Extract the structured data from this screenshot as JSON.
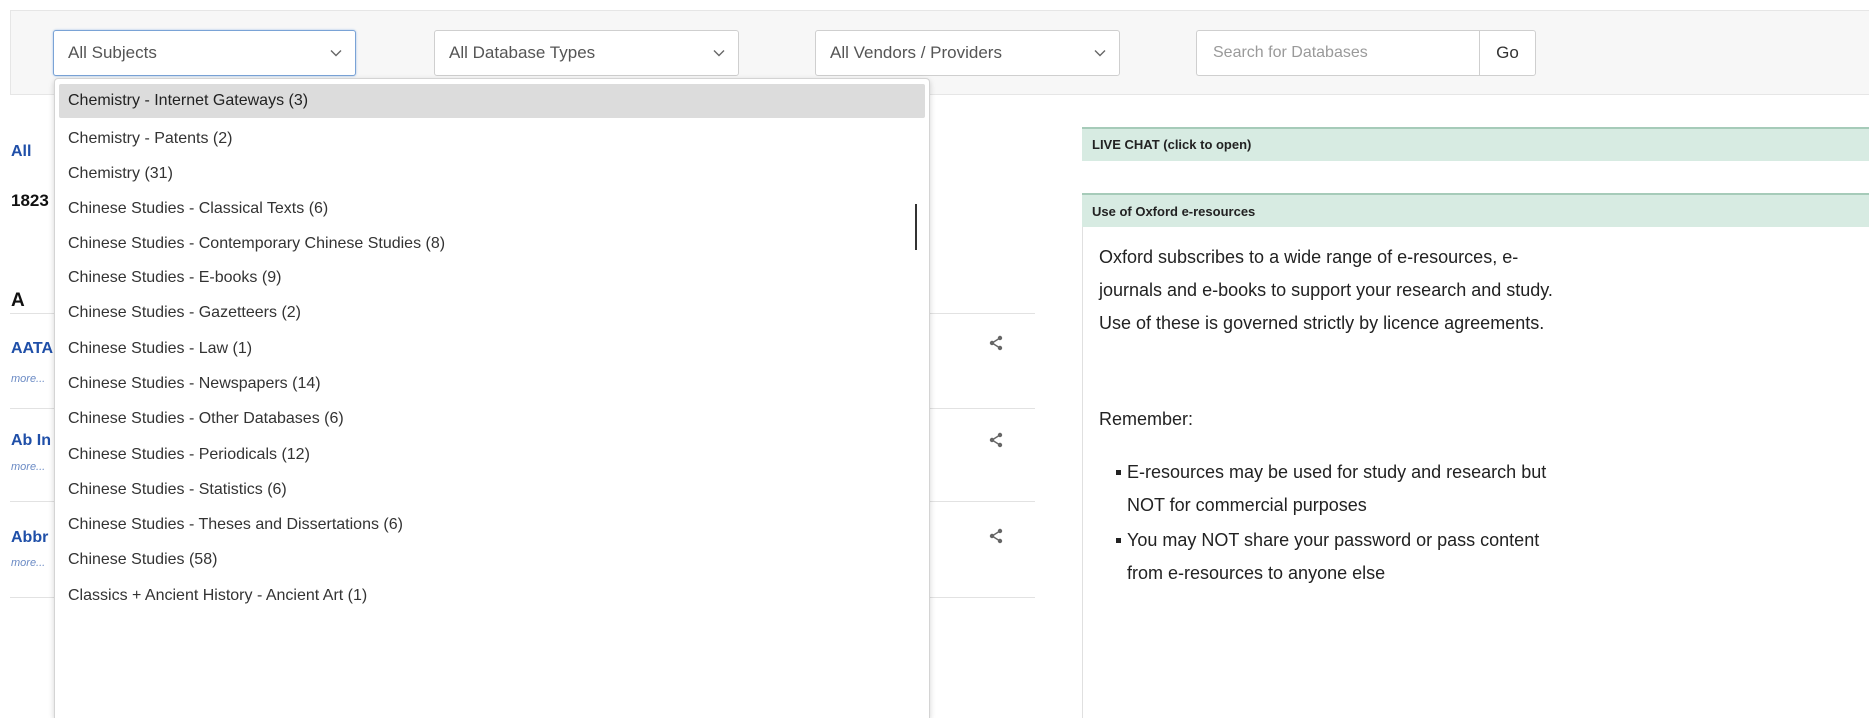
{
  "filters": {
    "subjects": {
      "selected": "All Subjects"
    },
    "types": {
      "selected": "All Database Types"
    },
    "vendors": {
      "selected": "All Vendors / Providers"
    },
    "search": {
      "placeholder": "Search for Databases",
      "value": ""
    },
    "go_label": "Go"
  },
  "list": {
    "az_all": "All",
    "count": "1823",
    "letter": "A",
    "items": [
      {
        "title": "AATA",
        "more": "more..."
      },
      {
        "title": "Ab In",
        "more": "more..."
      },
      {
        "title": "Abbr",
        "more": "more..."
      }
    ]
  },
  "dropdown": {
    "options": [
      "Chemistry - Internet Gateways (3)",
      "Chemistry - Patents (2)",
      "Chemistry (31)",
      "Chinese Studies - Classical Texts (6)",
      "Chinese Studies - Contemporary Chinese Studies (8)",
      "Chinese Studies - E-books (9)",
      "Chinese Studies - Gazetteers (2)",
      "Chinese Studies - Law (1)",
      "Chinese Studies - Newspapers (14)",
      "Chinese Studies - Other Databases (6)",
      "Chinese Studies - Periodicals (12)",
      "Chinese Studies - Statistics (6)",
      "Chinese Studies - Theses and Dissertations (6)",
      "Chinese Studies (58)",
      "Classics + Ancient History - Ancient Art (1)"
    ],
    "highlighted_index": 0
  },
  "sidebar": {
    "chat_label": "LIVE CHAT (click to open)",
    "oxford_title": "Use of Oxford e-resources",
    "oxford_para": "Oxford subscribes to a wide range of e-resources, e-journals and e-books to support your research and study. Use of these is governed strictly by licence agreements.",
    "remember": "Remember:",
    "bullets": [
      "E-resources may be used for study and research but NOT for commercial purposes",
      "You may NOT share your password or pass content from e-resources to anyone else"
    ]
  },
  "colors": {
    "link": "#1f4fa8",
    "sidebar_header_bg": "#d7ebe2",
    "dropdown_highlight": "#dcdcdc"
  },
  "icons": {
    "chevron": "chevron-down-icon",
    "share": "share-icon"
  }
}
